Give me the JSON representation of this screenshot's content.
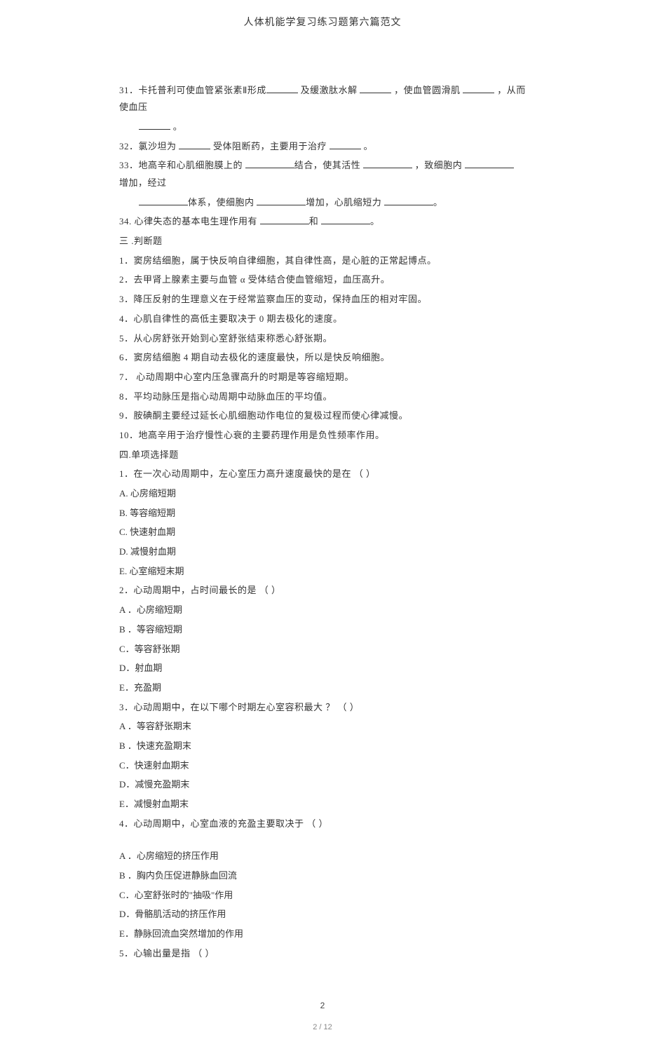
{
  "header": {
    "title": "人体机能学复习练习题第六篇范文"
  },
  "fill": {
    "q31_pre": "31．卡托普利可使血管紧张素Ⅱ形成",
    "q31_mid1": "  及缓激肽水解  ",
    "q31_mid2": " ，使血管圆滑肌  ",
    "q31_mid3": " ，从而使血压",
    "q31_end": " 。",
    "q32_pre": "32．氯沙坦为 ",
    "q32_mid": "  受体阻断药，主要用于治疗  ",
    "q32_end": " 。",
    "q33_pre": "33．地高辛和心肌细胞膜上的   ",
    "q33_a": "结合，使其活性   ",
    "q33_b": " ，致细胞内  ",
    "q33_c": " 增加，经过",
    "q33_line2_pre": " ",
    "q33_d": "体系，使细胞内  ",
    "q33_e": "增加，心肌缩短力  ",
    "q33_f": "。",
    "q34_pre": "34. 心律失态的基本电生理作用有   ",
    "q34_mid": "和 ",
    "q34_end": "。"
  },
  "sec3_title": "三 .判断题",
  "judge": [
    "1．窦房结细胞，属于快反响自律细胞，其自律性高，是心脏的正常起博点。",
    "2．去甲肾上腺素主要与血管     α  受体结合使血管缩短，血压高升。",
    "3．降压反射的生理意义在于经常监察血压的变动，保持血压的相对牢固。",
    "4．心肌自律性的高低主要取决于       0 期去极化的速度。",
    "5．从心房舒张开始到心室舒张结束称悉心舒张期。",
    "6．窦房结细胞   4 期自动去极化的速度最快，所以是快反响细胞。",
    "7． 心动周期中心室内压急骤高升的时期是等容缩短期。",
    "8．平均动脉压是指心动周期中动脉血压的平均值。",
    "9．胺碘酮主要经过延长心肌细胞动作电位的复极过程而使心律减慢。",
    "10．地高辛用于治疗慢性心衰的主要药理作用是负性频率作用。"
  ],
  "sec4_title": "四.单项选择题",
  "mcq": [
    {
      "q": "1．在一次心动周期中，左心室压力高升速度最快的是在               （     ）",
      "opts": [
        "A.      心房缩短期",
        "B.      等容缩短期",
        "C.      快速射血期",
        "D.      减慢射血期",
        "E.      心室缩短末期"
      ]
    },
    {
      "q": "2．心动周期中，占时间最长的是          （     ）",
      "opts": [
        "A ．心房缩短期",
        "B ．等容缩短期",
        "C．等容舒张期",
        "D．射血期",
        "E．充盈期"
      ]
    },
    {
      "q": "3．心动周期中，在以下哪个时期左心室容积最大        ？     （     ）",
      "opts": [
        "A ．等容舒张期末",
        "B ．快速充盈期末",
        "C．快速射血期末",
        "D．减慢充盈期末",
        "E．减慢射血期末"
      ]
    },
    {
      "q": "4．心动周期中，心室血液的充盈主要取决于           （     ）",
      "opts": [
        "A ．心房缩短的挤压作用",
        "B ．胸内负压促进静脉血回流",
        "C．心室舒张时的\"抽吸\"作用",
        "D．骨骼肌活动的挤压作用",
        "E．静脉回流血突然增加的作用"
      ],
      "gap": true
    },
    {
      "q": "5．心输出量是指       （     ）",
      "opts": []
    }
  ],
  "footer": {
    "pagenum": "2",
    "pageinfo": "2 / 12"
  }
}
